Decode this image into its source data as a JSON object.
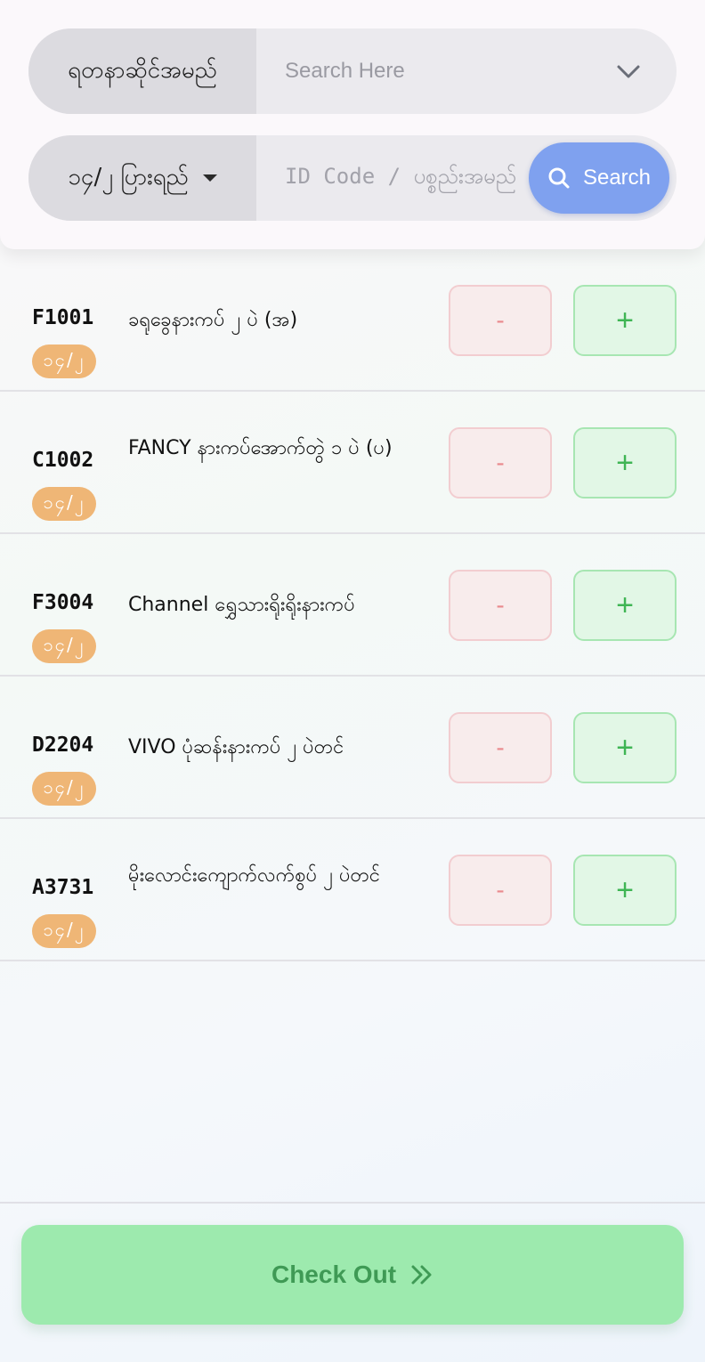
{
  "header": {
    "category_label": "ရတနာဆိုင်အမည်",
    "search_placeholder": "Search Here",
    "filter_label": "၁၄/၂ ပြားရည်",
    "code_placeholder": "ID Code / ပစ္စည်းအမည်",
    "search_button_label": "Search"
  },
  "items": [
    {
      "code": "F1001",
      "badge": "၁၄/၂",
      "name": "ခရုခွေနားကပ် ၂ ပဲ (အ)",
      "minus_label": "-",
      "plus_label": "+"
    },
    {
      "code": "C1002",
      "badge": "၁၄/၂",
      "name": "FANCY နားကပ်အောက်တွဲ ၁ ပဲ (ပ)",
      "minus_label": "-",
      "plus_label": "+"
    },
    {
      "code": "F3004",
      "badge": "၁၄/၂",
      "name": "Channel ရွှေသားရိုးရိုးနားကပ်",
      "minus_label": "-",
      "plus_label": "+"
    },
    {
      "code": "D2204",
      "badge": "၁၄/၂",
      "name": "VIVO ပုံဆန်းနားကပ် ၂ ပဲတင်",
      "minus_label": "-",
      "plus_label": "+"
    },
    {
      "code": "A3731",
      "badge": "၁၄/၂",
      "name": "မိုးလောင်းကျောက်လက်စွပ် ၂ ပဲတင်",
      "minus_label": "-",
      "plus_label": "+"
    }
  ],
  "footer": {
    "checkout_label": "Check Out"
  },
  "colors": {
    "accent_blue": "#7fa1ef",
    "badge_orange": "#efb676",
    "plus_green": "#3fb554",
    "minus_red": "#ea8a8e",
    "checkout_bg": "#9deaae"
  }
}
